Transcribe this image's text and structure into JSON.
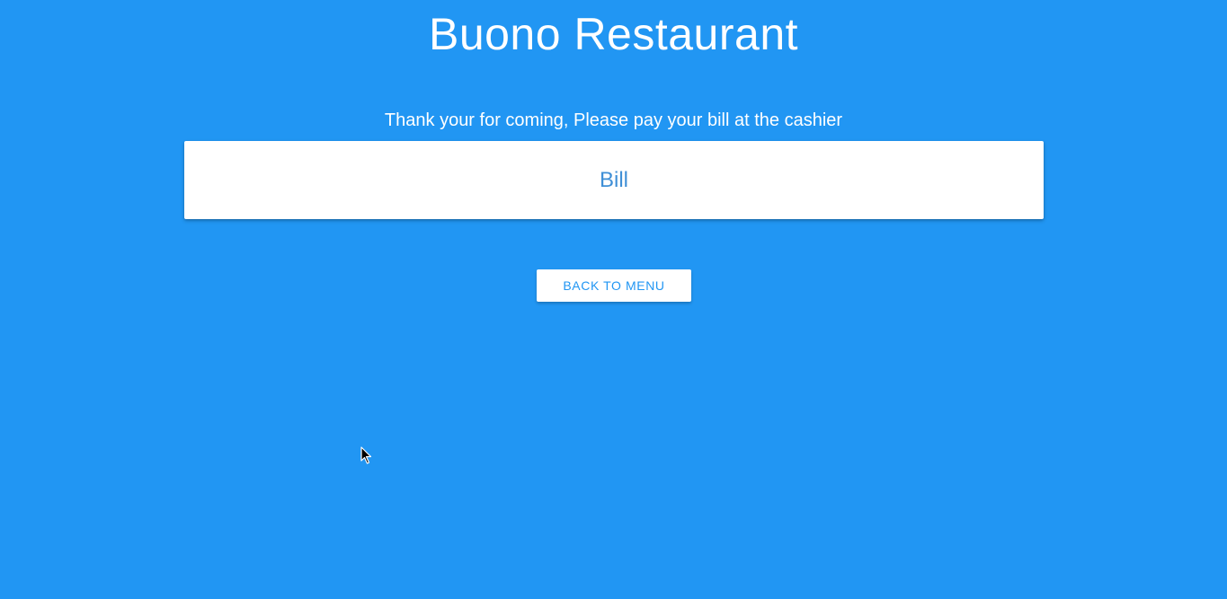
{
  "header": {
    "title": "Buono Restaurant"
  },
  "main": {
    "message": "Thank your for coming, Please pay your bill at the cashier",
    "bill_card": {
      "label": "Bill"
    },
    "back_button": {
      "label": "BACK TO MENU"
    }
  },
  "colors": {
    "background": "#2196f3",
    "card": "#ffffff",
    "accent": "#2196f3"
  },
  "icons": {
    "cursor": "mouse-pointer-icon"
  }
}
